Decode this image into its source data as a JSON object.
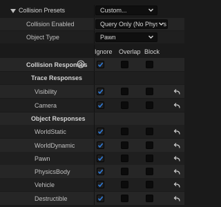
{
  "collision_presets": {
    "label": "Collision Presets",
    "value": "Custom..."
  },
  "collision_enabled": {
    "label": "Collision Enabled",
    "value": "Query Only (No Physics C"
  },
  "object_type": {
    "label": "Object Type",
    "value": "Pawn"
  },
  "columns": {
    "ignore": "Ignore",
    "overlap": "Overlap",
    "block": "Block"
  },
  "collision_responses": {
    "label": "Collision Responses",
    "help_icon": "help-icon"
  },
  "trace_responses": {
    "label": "Trace Responses",
    "items": [
      {
        "label": "Visibility",
        "ignore": true,
        "overlap": false,
        "block": false
      },
      {
        "label": "Camera",
        "ignore": true,
        "overlap": false,
        "block": false
      }
    ]
  },
  "object_responses": {
    "label": "Object Responses",
    "items": [
      {
        "label": "WorldStatic",
        "ignore": true,
        "overlap": false,
        "block": false
      },
      {
        "label": "WorldDynamic",
        "ignore": true,
        "overlap": false,
        "block": false
      },
      {
        "label": "Pawn",
        "ignore": true,
        "overlap": false,
        "block": false
      },
      {
        "label": "PhysicsBody",
        "ignore": true,
        "overlap": false,
        "block": false
      },
      {
        "label": "Vehicle",
        "ignore": true,
        "overlap": false,
        "block": false
      },
      {
        "label": "Destructible",
        "ignore": true,
        "overlap": false,
        "block": false
      }
    ]
  },
  "colors": {
    "accent": "#2f7bd9",
    "background": "#1a1a1a",
    "row": "#242424",
    "text": "#c0c0c0"
  },
  "icons": {
    "expand": "triangle-down-icon",
    "dropdown": "chevron-down-icon",
    "reset": "reset-arrow-icon",
    "check": "checkmark-icon"
  }
}
